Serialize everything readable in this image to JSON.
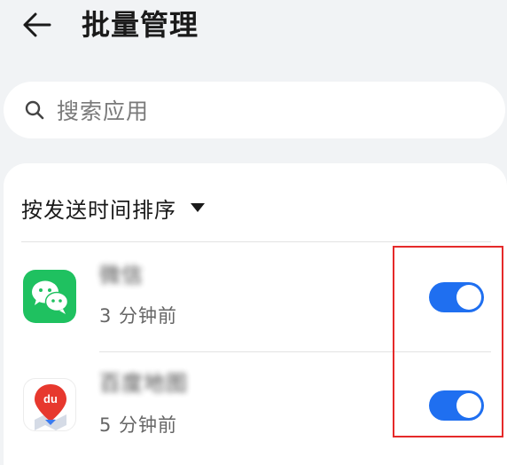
{
  "header": {
    "title": "批量管理",
    "back_icon": "arrow-left-icon"
  },
  "search": {
    "placeholder": "搜索应用",
    "icon": "search-icon"
  },
  "sort": {
    "label": "按发送时间排序",
    "icon": "caret-down-icon"
  },
  "apps": [
    {
      "name": "微信",
      "time": "3 分钟前",
      "enabled": true,
      "icon": "wechat-icon",
      "icon_color": "#1fc160"
    },
    {
      "name": "百度地图",
      "time": "5 分钟前",
      "enabled": true,
      "icon": "baidu-map-icon",
      "icon_color": "#e7382e"
    }
  ],
  "colors": {
    "toggle_on": "#1f6ff0",
    "highlight": "#e52a2a",
    "background": "#f1f3f5"
  }
}
